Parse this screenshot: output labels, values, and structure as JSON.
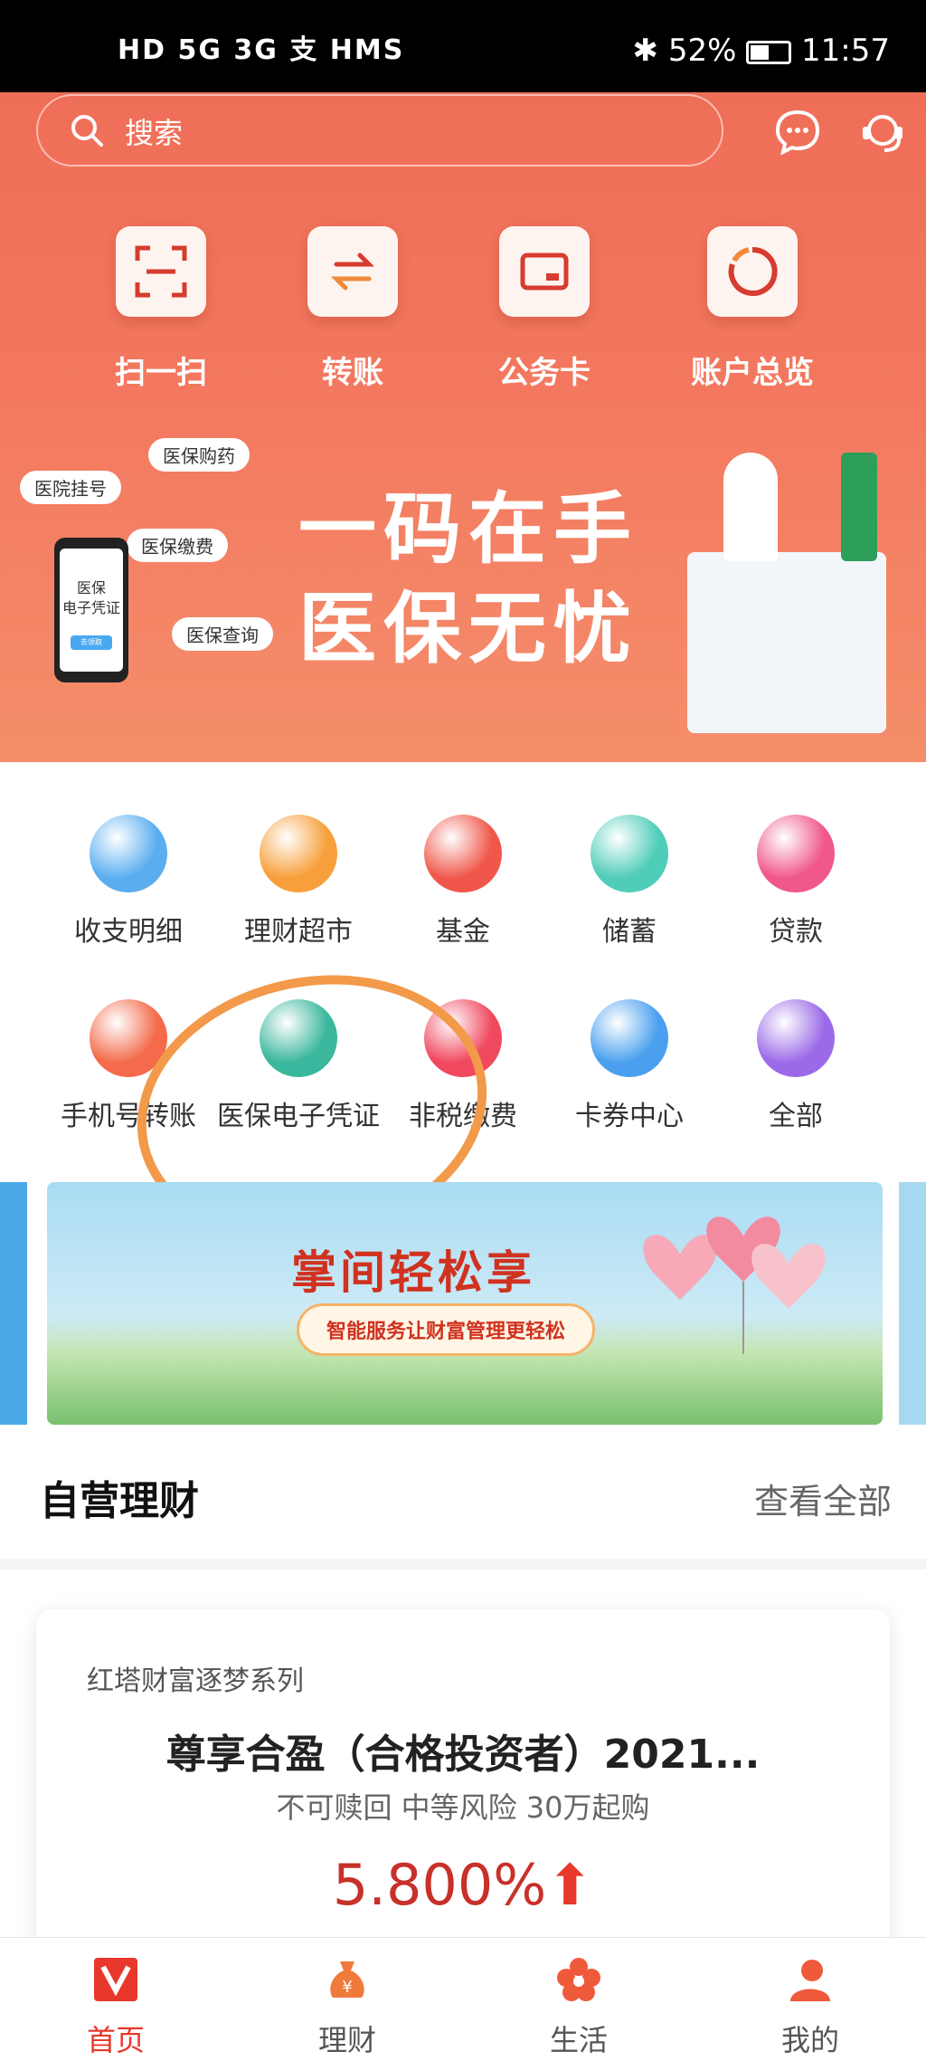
{
  "status_bar": {
    "left": "HD 5G 3G 支 HMS",
    "battery": "52%",
    "time": "11:57"
  },
  "search": {
    "placeholder": "搜索",
    "icons": [
      "search-icon",
      "message-icon",
      "customer-service-icon"
    ]
  },
  "quick_actions": [
    {
      "label": "扫一扫",
      "icon": "scan-icon"
    },
    {
      "label": "转账",
      "icon": "transfer-icon"
    },
    {
      "label": "公务卡",
      "icon": "card-icon"
    },
    {
      "label": "账户总览",
      "icon": "overview-icon"
    }
  ],
  "banner": {
    "line1": "一码在手",
    "line2": "医保无忧",
    "bubbles": [
      "医院挂号",
      "医保购药",
      "医保缴费",
      "医保查询"
    ],
    "phone_text": "医保\n电子凭证",
    "phone_button": "去领取"
  },
  "services": [
    {
      "label": "收支明细",
      "color": "#5aaef0"
    },
    {
      "label": "理财超市",
      "color": "#f7a03b"
    },
    {
      "label": "基金",
      "color": "#f0574a"
    },
    {
      "label": "储蓄",
      "color": "#4fcdb8"
    },
    {
      "label": "贷款",
      "color": "#f0578a"
    },
    {
      "label": "手机号转账",
      "color": "#f46a4a"
    },
    {
      "label": "医保电子凭证",
      "color": "#3ab79c"
    },
    {
      "label": "非税缴费",
      "color": "#f0485e"
    },
    {
      "label": "卡券中心",
      "color": "#4aa0ef"
    },
    {
      "label": "全部",
      "color": "#9a6ae8"
    }
  ],
  "promo": {
    "title": "掌间轻松享",
    "subtitle": "智能服务让财富管理更轻松"
  },
  "section": {
    "title": "自营理财",
    "more": "查看全部"
  },
  "product": {
    "series": "红塔财富逐梦系列",
    "name": "尊享合盈（合格投资者）2021...",
    "tags": "不可赎回  中等风险  30万起购",
    "rate": "5.800%"
  },
  "bottom_nav": [
    {
      "label": "首页",
      "active": true
    },
    {
      "label": "理财",
      "active": false
    },
    {
      "label": "生活",
      "active": false
    },
    {
      "label": "我的",
      "active": false
    }
  ]
}
